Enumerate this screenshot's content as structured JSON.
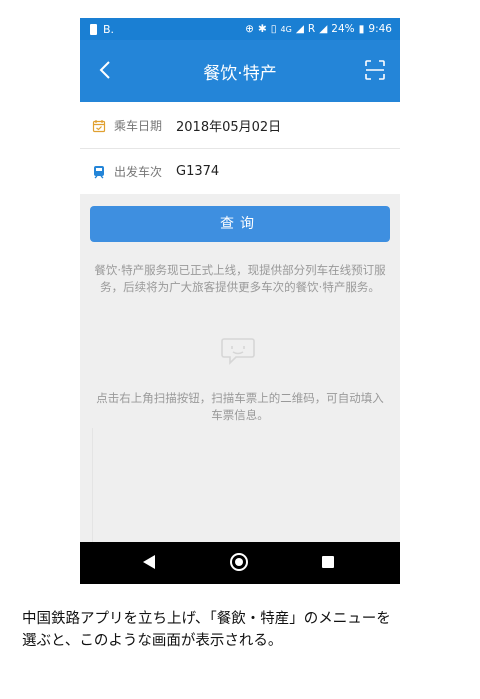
{
  "status_bar": {
    "left_letter": "B.",
    "network": "4G",
    "roaming": "R",
    "battery": "24%",
    "time": "9:46"
  },
  "nav": {
    "title": "餐饮·特产",
    "back_icon": "chevron-left-icon",
    "scan_icon": "scan-icon"
  },
  "form": {
    "date_label": "乘车日期",
    "date_value": "2018年05月02日",
    "train_label": "出发车次",
    "train_value": "G1374"
  },
  "query_button": "查询",
  "notice": "餐饮·特产服务现已正式上线，现提供部分列车在线预订服务，后续将为广大旅客提供更多车次的餐饮·特产服务。",
  "hint": "点击右上角扫描按钮，扫描车票上的二维码，可自动填入车票信息。",
  "caption": {
    "line1": "中国鉄路アプリを立ち上げ、「餐飲・特産」のメニューを",
    "line2": "選ぶと、このような画面が表示される。"
  },
  "colors": {
    "status_bar": "#1a7fd3",
    "nav_bar": "#2485d8",
    "button": "#3e8fe0",
    "background": "#efefef"
  }
}
